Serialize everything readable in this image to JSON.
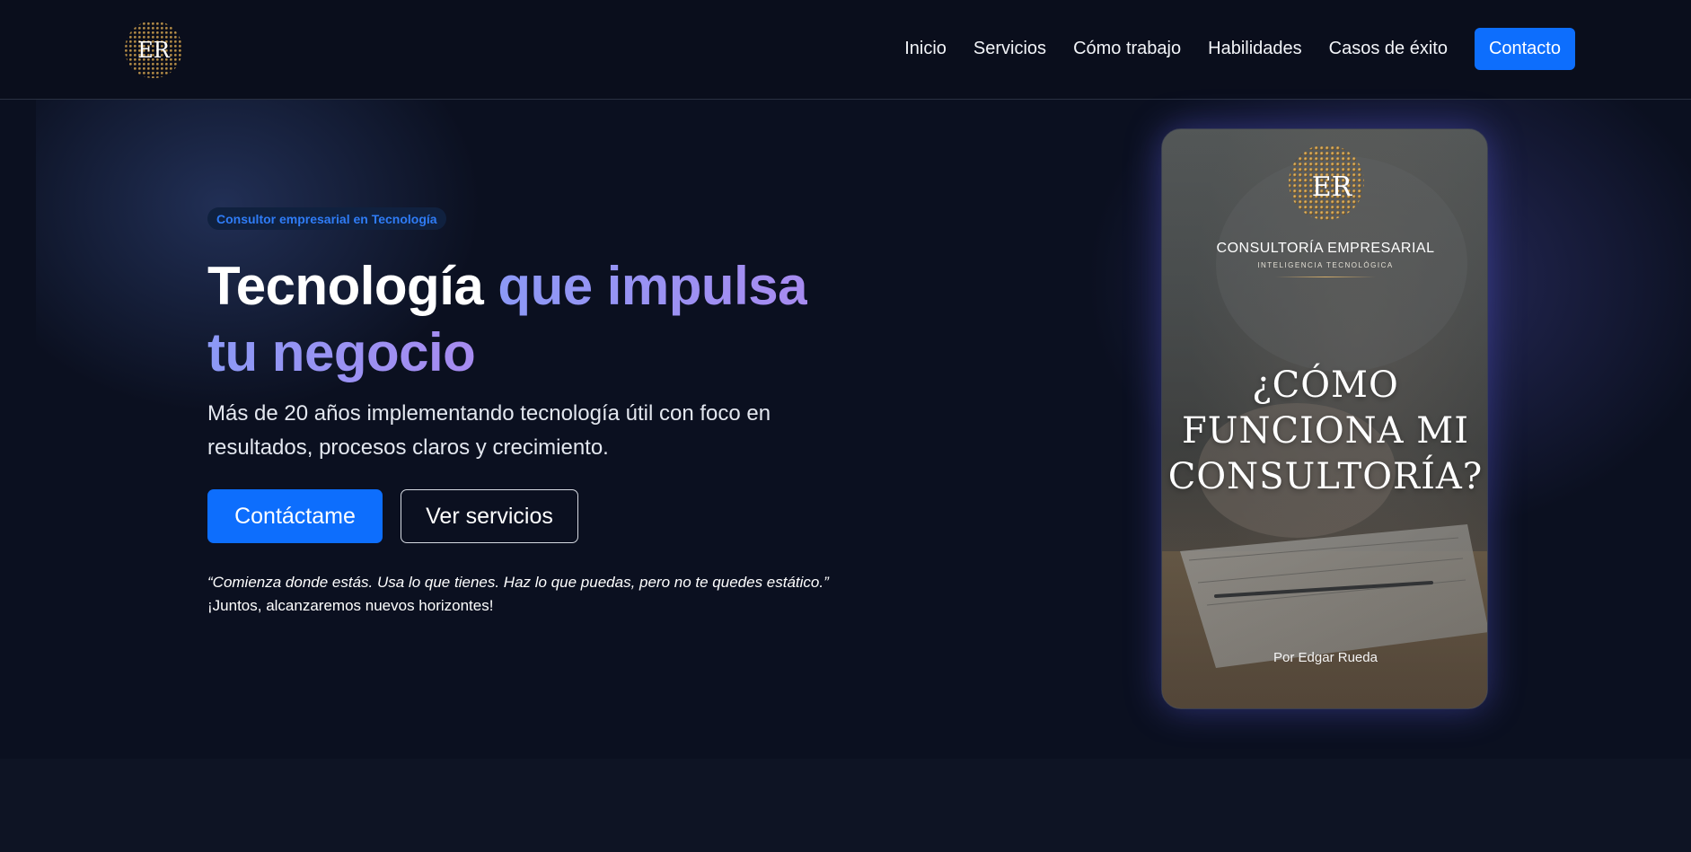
{
  "header": {
    "logo_text": "ER",
    "nav": [
      {
        "label": "Inicio"
      },
      {
        "label": "Servicios"
      },
      {
        "label": "Cómo trabajo"
      },
      {
        "label": "Habilidades"
      },
      {
        "label": "Casos de éxito"
      }
    ],
    "cta_label": "Contacto"
  },
  "hero": {
    "badge": "Consultor empresarial en Tecnología",
    "title_part1": "Tecnología",
    "title_part2": "que impulsa",
    "title_part3": "tu negocio",
    "subtitle": "Más de 20 años implementando tecnología útil con foco en resultados, procesos claros y crecimiento.",
    "primary_button": "Contáctame",
    "secondary_button": "Ver servicios",
    "quote": "“Comienza donde estás. Usa lo que tienes. Haz lo que puedas, pero no te quedes estático.”",
    "quote_followup": "¡Juntos, alcanzaremos nuevos horizontes!"
  },
  "card": {
    "logo_text": "ER",
    "brand": "CONSULTORÍA EMPRESARIAL",
    "tagline": "INTELIGENCIA TECNOLÓGICA",
    "headline_lines": [
      "¿CÓMO",
      "FUNCIONA MI",
      "CONSULTORÍA?"
    ],
    "author": "Por Edgar Rueda"
  },
  "colors": {
    "accent": "#0d6efd",
    "title_gradient_start": "#8c99f6",
    "title_gradient_end": "#a78bf0",
    "background": "#0b1020"
  }
}
